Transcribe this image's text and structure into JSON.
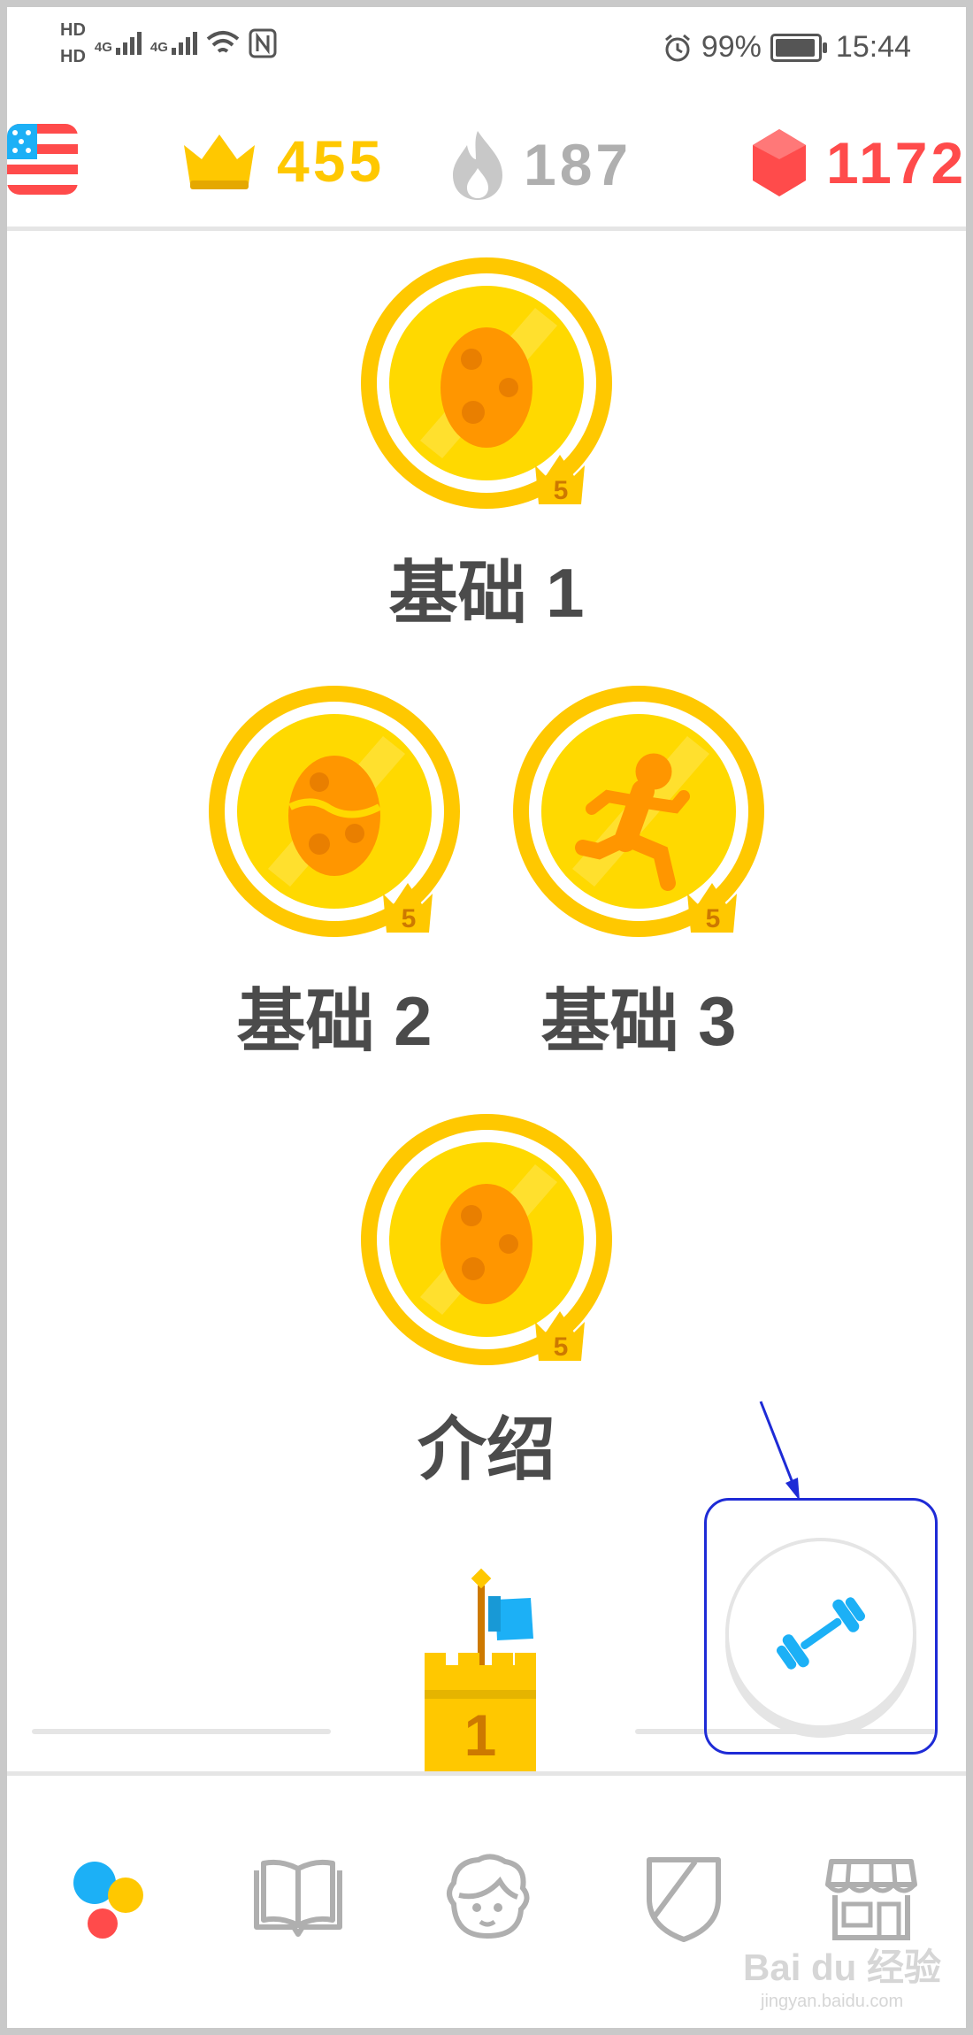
{
  "status_bar": {
    "sim1": "HD",
    "sim2": "HD",
    "net1": "4G",
    "net2": "4G",
    "battery": "99%",
    "time": "15:44"
  },
  "stats": {
    "language_flag": "us-flag-icon",
    "crowns": "455",
    "streak": "187",
    "gems": "1172",
    "colors": {
      "crown": "#ffc800",
      "streak": "#afafaf",
      "gem": "#ff4b4b"
    }
  },
  "skills": [
    {
      "label": "基础 1",
      "level": "5",
      "icon": "egg-icon"
    },
    {
      "label": "基础 2",
      "level": "5",
      "icon": "cracked-egg-icon"
    },
    {
      "label": "基础 3",
      "level": "5",
      "icon": "running-person-icon"
    },
    {
      "label": "介绍",
      "level": "5",
      "icon": "egg-icon"
    }
  ],
  "checkpoint": {
    "number": "1"
  },
  "practice_button": {
    "icon": "dumbbell-icon"
  },
  "tabs": [
    {
      "name": "learn",
      "icon": "learn-dots-icon"
    },
    {
      "name": "stories",
      "icon": "book-icon"
    },
    {
      "name": "profile",
      "icon": "avatar-face-icon"
    },
    {
      "name": "leagues",
      "icon": "shield-icon"
    },
    {
      "name": "shop",
      "icon": "shop-icon"
    }
  ],
  "watermark": {
    "brand": "Bai du 经验",
    "url": "jingyan.baidu.com"
  }
}
